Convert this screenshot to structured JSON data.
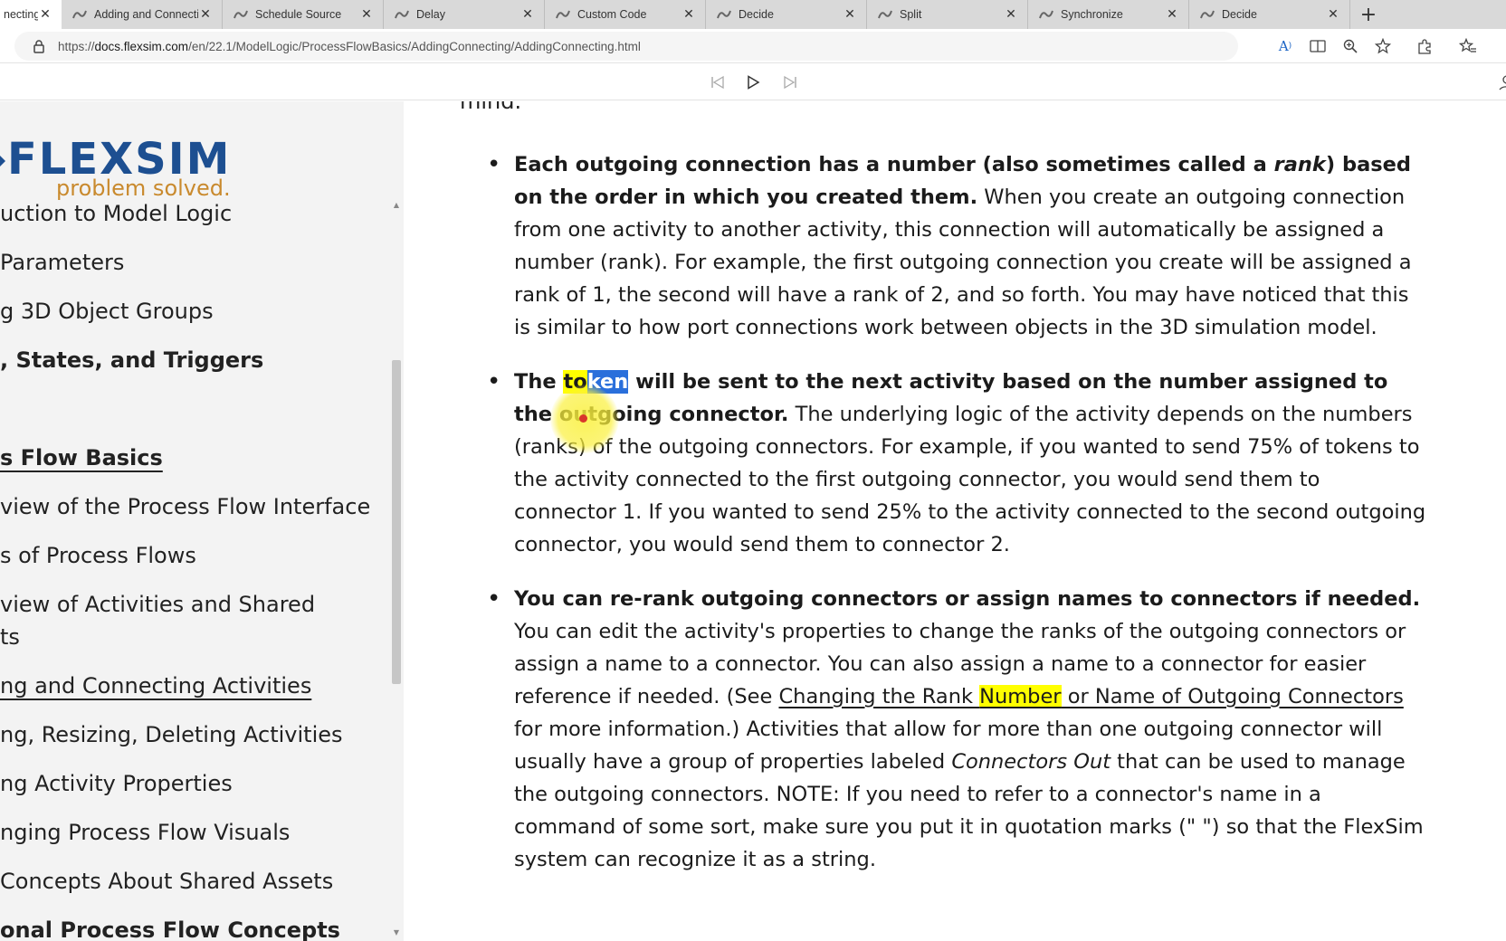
{
  "tabs": [
    {
      "label": "necting",
      "active": true
    },
    {
      "label": "Adding and Connecting",
      "active": false
    },
    {
      "label": "Schedule Source",
      "active": false
    },
    {
      "label": "Delay",
      "active": false
    },
    {
      "label": "Custom Code",
      "active": false
    },
    {
      "label": "Decide",
      "active": false
    },
    {
      "label": "Split",
      "active": false
    },
    {
      "label": "Synchronize",
      "active": false
    },
    {
      "label": "Decide",
      "active": false
    }
  ],
  "address_bar": {
    "url_prefix": "https://",
    "url_domain": "docs.flexsim.com",
    "url_path": "/en/22.1/ModelLogic/ProcessFlowBasics/AddingConnecting/AddingConnecting.html"
  },
  "logo": {
    "brand": "FLEXSIM",
    "tagline": "problem solved."
  },
  "sidebar": {
    "items": [
      {
        "label": "uction to Model Logic"
      },
      {
        "label": " Parameters"
      },
      {
        "label": "g 3D Object Groups"
      },
      {
        "label": ", States, and Triggers"
      },
      {
        "label": "s Flow Basics"
      },
      {
        "label": "view of the Process Flow Interface"
      },
      {
        "label": "s of Process Flows"
      },
      {
        "label": "view of Activities and Shared"
      },
      {
        "label": "ts"
      },
      {
        "label": "ng and Connecting Activities"
      },
      {
        "label": "ng, Resizing, Deleting Activities"
      },
      {
        "label": "ng Activity Properties"
      },
      {
        "label": "nging Process Flow Visuals"
      },
      {
        "label": "Concepts About Shared Assets"
      },
      {
        "label": "onal Process Flow Concepts"
      }
    ]
  },
  "content": {
    "top_fragment": "mind.",
    "bullet1": {
      "b1": "Each outgoing connection has a number (also sometimes called a ",
      "bi": "rank",
      "b2": ") based on the order in which you created them.",
      "text": " When you create an outgoing connection from one activity to another activity, this connection will automatically be assigned a number (rank). For example, the first outgoing connection you create will be assigned a rank of 1, the second will have a rank of 2, and so forth. You may have noticed that this is similar to how port connections work between objects in the 3D simulation model."
    },
    "bullet2": {
      "b1": "The ",
      "b_sel1": "to",
      "b_sel2": "ken",
      "b2": " will be sent to the next activity based on the number assigned to the outgoing connector.",
      "text": " The underlying logic of the activity depends on the numbers (ranks) of the outgoing connectors. For example, if you wanted to send 75% of tokens to the activity connected to the first outgoing connector, you would send them to connector 1. If you wanted to send 25% to the activity connected to the second outgoing connector, you would send them to connector 2."
    },
    "bullet3": {
      "b1": "You can re-rank outgoing connectors or assign names to connectors if needed.",
      "t1": " You can edit the activity's properties to change the ranks of the outgoing connectors or assign a name to a connector. You can also assign a name to a connector for easier reference if needed. (See ",
      "link1": "Changing the Rank ",
      "link_hl": "Number",
      "link2": " or Name of Outgoing Connectors",
      "t2": " for more information.) Activities that allow for more than one outgoing connector will usually have a group of properties labeled ",
      "ti": "Connectors Out",
      "t3": " that can be used to manage the outgoing connectors. NOTE: If you need to refer to a connector's name in a command of some sort, make sure you put it in quotation marks (\" \") so that the FlexSim system can recognize it as a string."
    }
  },
  "colors": {
    "highlight_yellow": "#ffff00",
    "selection_blue": "#2a6fdb",
    "logo_blue": "#1d4f91",
    "logo_orange": "#c98a2e"
  }
}
